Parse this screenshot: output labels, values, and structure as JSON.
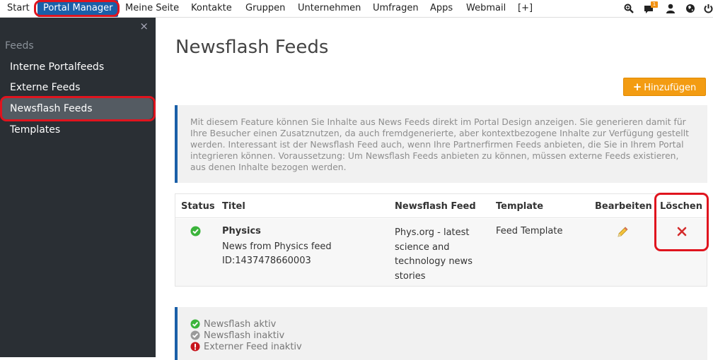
{
  "nav": {
    "items": [
      {
        "label": "Start"
      },
      {
        "label": "Portal Manager"
      },
      {
        "label": "Meine Seite"
      },
      {
        "label": "Kontakte"
      },
      {
        "label": "Gruppen"
      },
      {
        "label": "Unternehmen"
      },
      {
        "label": "Umfragen"
      },
      {
        "label": "Apps"
      },
      {
        "label": "Webmail"
      },
      {
        "label": "[+]"
      }
    ],
    "notification_count": "1",
    "icons": [
      "search-icon",
      "chat-icon",
      "user-icon",
      "globe-icon",
      "power-icon"
    ]
  },
  "sidebar": {
    "close_symbol": "×",
    "header": "Feeds",
    "items": [
      {
        "label": "Interne Portalfeeds"
      },
      {
        "label": "Externe Feeds"
      },
      {
        "label": "Newsflash Feeds"
      },
      {
        "label": "Templates"
      }
    ]
  },
  "main": {
    "title": "Newsflash Feeds",
    "add_button": "Hinzufügen",
    "info": "Mit diesem Feature können Sie Inhalte aus News Feeds direkt im Portal Design anzeigen. Sie generieren damit für Ihre Besucher einen Zusatznutzen, da auch fremdgenerierte, aber kontextbezogene Inhalte zur Verfügung gestellt werden. Interessant ist der Newsflash Feed auch, wenn Ihre Partnerfirmen Feeds anbieten, die Sie in Ihrem Portal integrieren können. Voraussetzung: Um Newsflash Feeds anbieten zu können, müssen externe Feeds existieren, aus denen Inhalte bezogen werden.",
    "table": {
      "headers": [
        "Status",
        "Titel",
        "Newsflash Feed",
        "Template",
        "Bearbeiten",
        "Löschen"
      ],
      "rows": [
        {
          "title": "Physics",
          "description": "News from Physics feed",
          "id": "ID:1437478660003",
          "feed": "Phys.org - latest science and technology news stories",
          "template": "Feed Template"
        }
      ]
    },
    "legend": [
      {
        "label": "Newsflash aktiv"
      },
      {
        "label": "Newsflash inaktiv"
      },
      {
        "label": "Externer Feed inaktiv"
      }
    ]
  },
  "colors": {
    "nav_active": "#1a5fa8",
    "sidebar_bg": "#2a2f34",
    "accent_orange": "#f39c12",
    "highlight_red": "#e0141e",
    "status_green": "#3bb43b"
  }
}
